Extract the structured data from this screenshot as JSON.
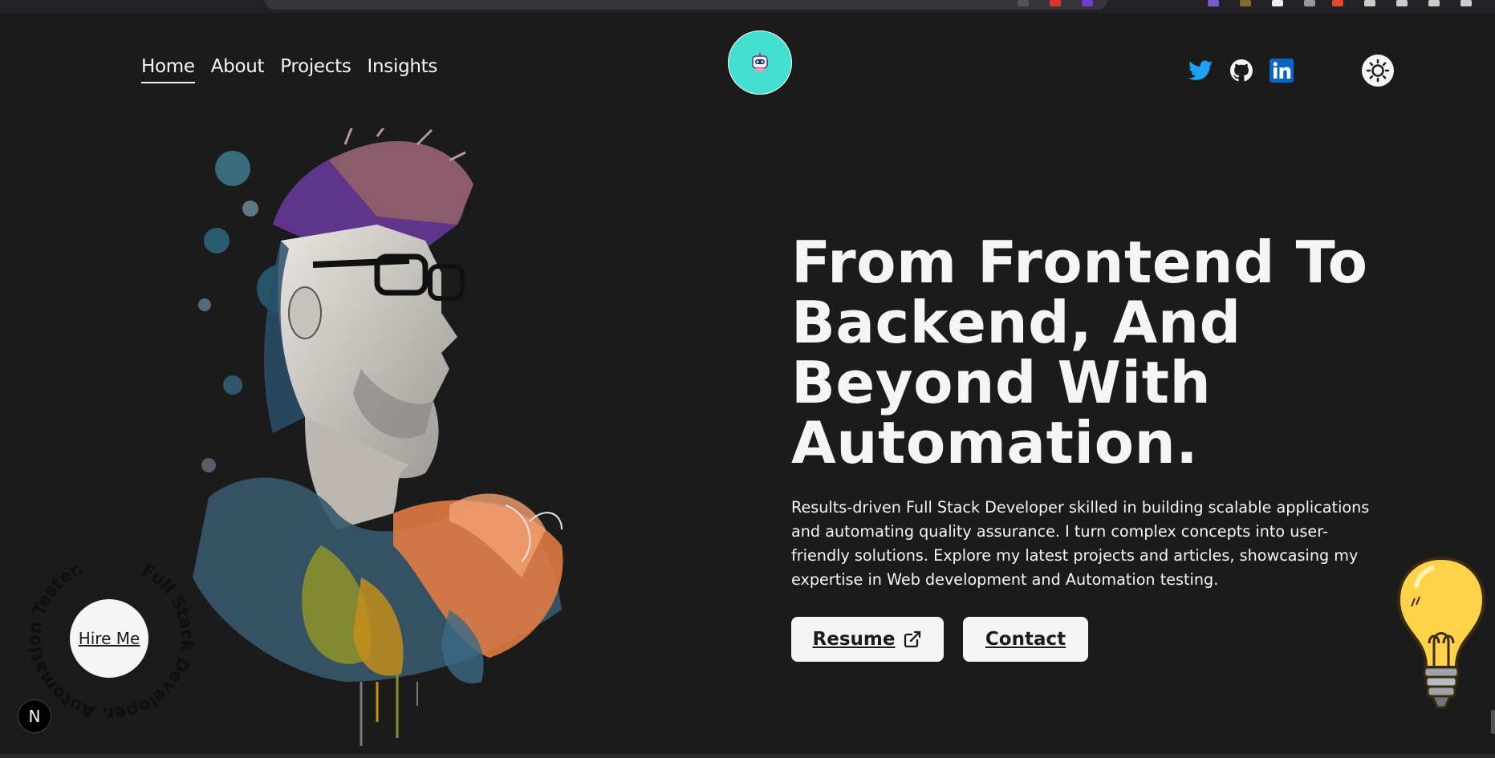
{
  "nav": {
    "items": [
      {
        "label": "Home",
        "active": true
      },
      {
        "label": "About",
        "active": false
      },
      {
        "label": "Projects",
        "active": false
      },
      {
        "label": "Insights",
        "active": false
      }
    ]
  },
  "logo": {
    "icon": "robot-icon",
    "color": "#44e0cf"
  },
  "social": [
    {
      "name": "twitter-icon",
      "color": "#1da1f2"
    },
    {
      "name": "github-icon",
      "color": "#f5f5f5"
    },
    {
      "name": "linkedin-icon",
      "color": "#0a66c2"
    }
  ],
  "theme_toggle": {
    "icon": "sun-icon"
  },
  "hero": {
    "headline": "From Frontend To Backend, And Beyond With Automation.",
    "intro": "Results-driven Full Stack Developer skilled in building scalable applications and automating quality assurance. I turn complex concepts into user-friendly solutions. Explore my latest projects and articles, showcasing my expertise in Web development and Automation testing.",
    "resume_label": "Resume",
    "contact_label": "Contact"
  },
  "hire": {
    "label": "Hire Me",
    "ring_text": "Full Stack Developer. Automation Tester. "
  },
  "badge": {
    "label": "N"
  },
  "colors": {
    "background": "#1b1b1b",
    "foreground": "#f5f5f5"
  }
}
